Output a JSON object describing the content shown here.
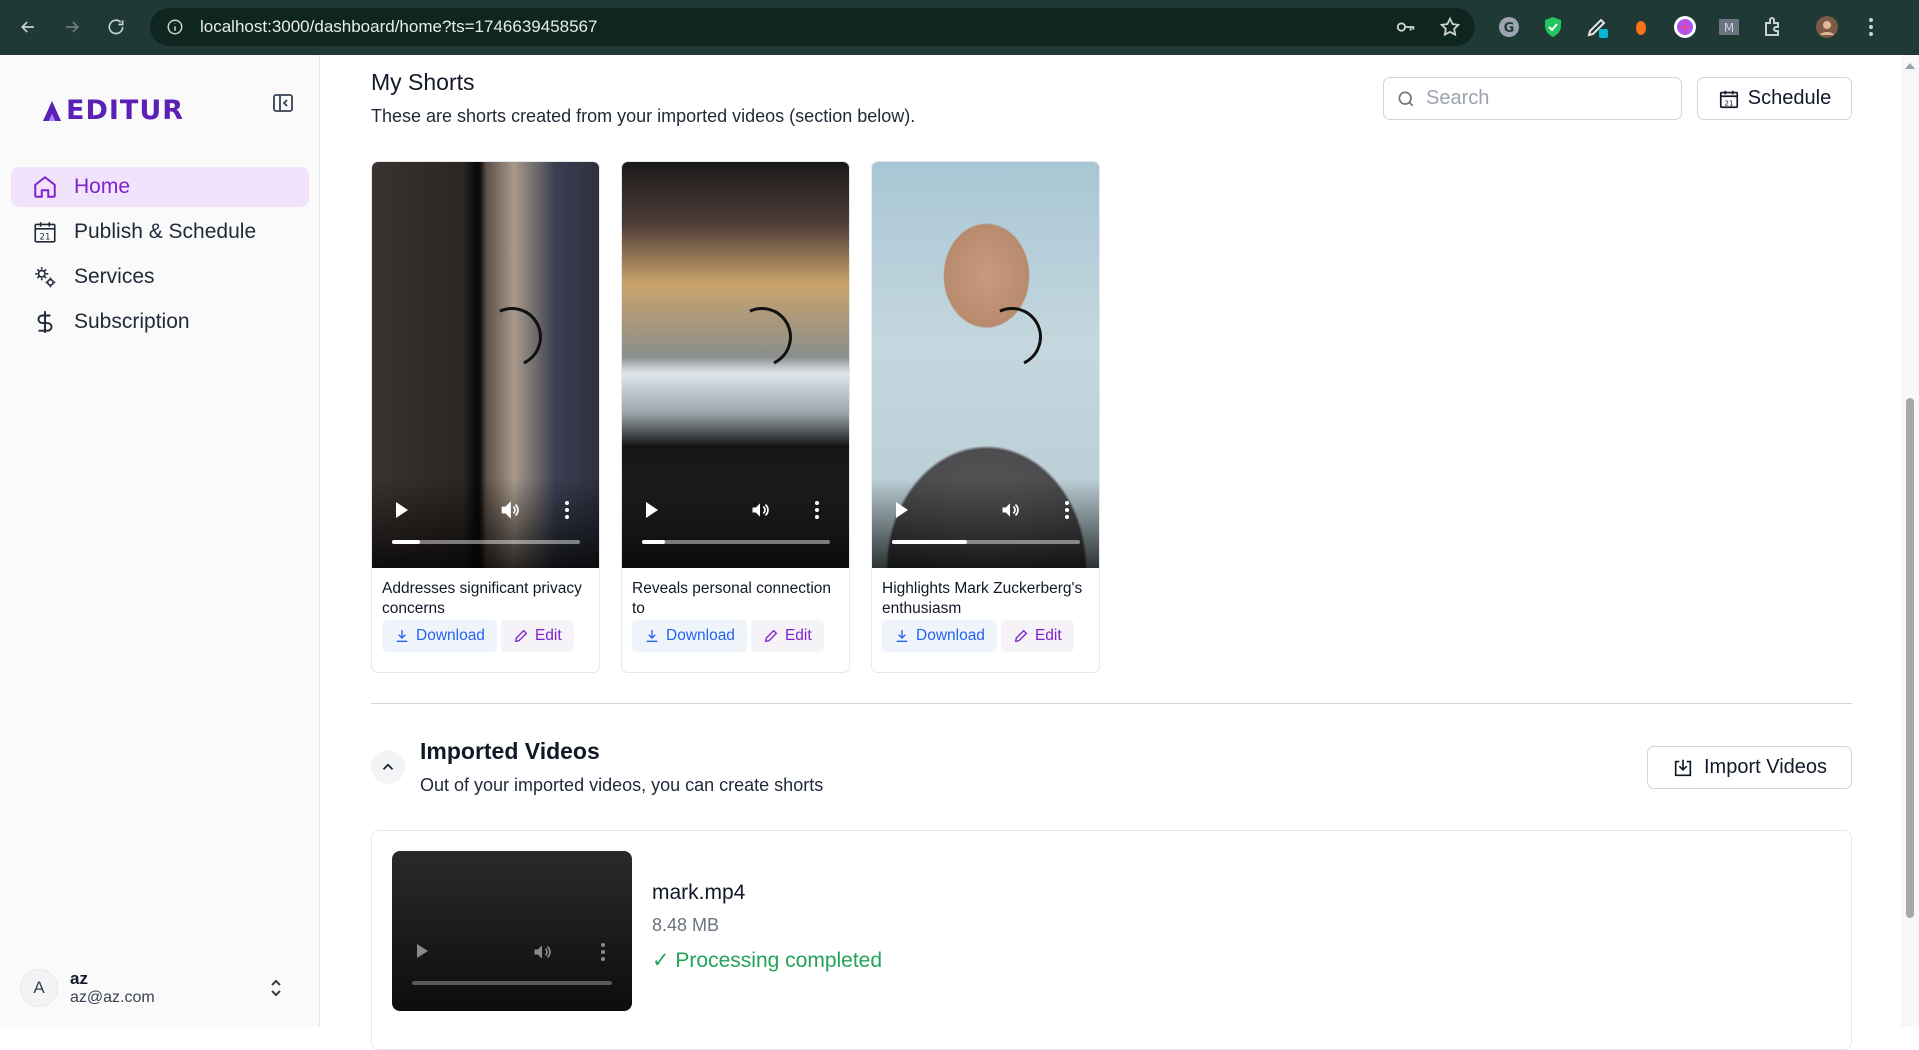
{
  "browser": {
    "url": "localhost:3000/dashboard/home?ts=1746639458567"
  },
  "sidebar": {
    "logo_text": "EDITUR",
    "items": [
      {
        "label": "Home",
        "icon": "home-icon",
        "active": true
      },
      {
        "label": "Publish & Schedule",
        "icon": "calendar-icon",
        "active": false
      },
      {
        "label": "Services",
        "icon": "gears-icon",
        "active": false
      },
      {
        "label": "Subscription",
        "icon": "dollar-icon",
        "active": false
      }
    ],
    "user": {
      "initial": "A",
      "name": "az",
      "email": "az@az.com"
    }
  },
  "header": {
    "title": "My Shorts",
    "subtitle": "These are shorts created from your imported videos (section below).",
    "search_placeholder": "Search",
    "schedule_label": "Schedule"
  },
  "shorts": [
    {
      "title": "Addresses significant privacy concerns",
      "download_label": "Download",
      "edit_label": "Edit",
      "progress": 0.15
    },
    {
      "title": "Reveals personal connection to",
      "download_label": "Download",
      "edit_label": "Edit",
      "progress": 0.12
    },
    {
      "title": "Highlights Mark Zuckerberg's enthusiasm",
      "download_label": "Download",
      "edit_label": "Edit",
      "progress": 0.4
    }
  ],
  "imported": {
    "title": "Imported Videos",
    "subtitle": "Out of your imported videos, you can create shorts",
    "import_label": "Import Videos",
    "videos": [
      {
        "filename": "mark.mp4",
        "size": "8.48 MB",
        "status": "✓ Processing completed"
      }
    ]
  },
  "colors": {
    "accent": "#7e22ce",
    "active_bg": "#f1e3fc",
    "download_blue": "#2563eb",
    "success_green": "#22a35a"
  }
}
